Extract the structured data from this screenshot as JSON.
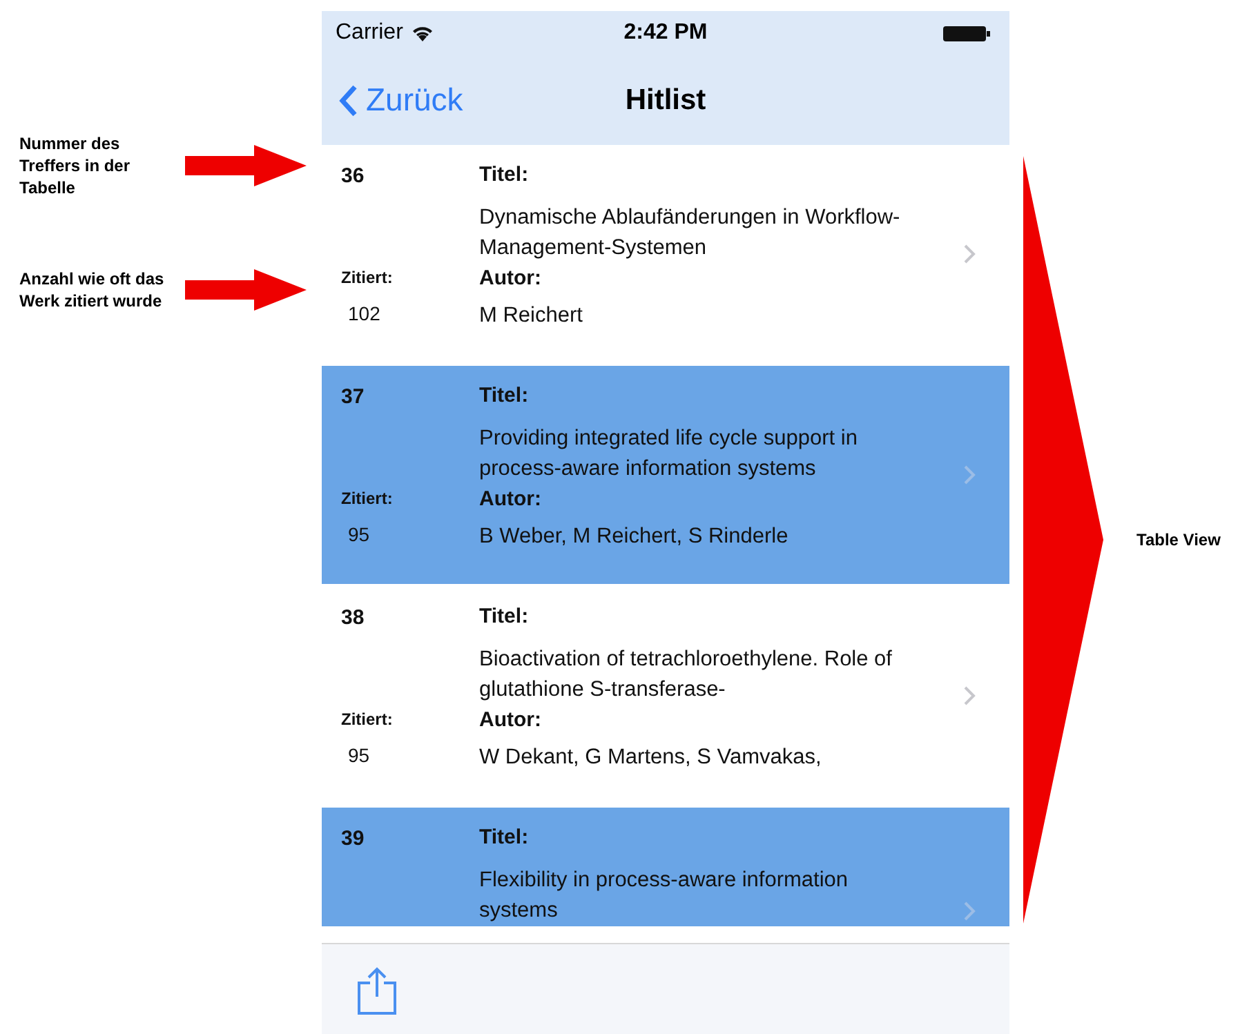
{
  "annotations": [
    {
      "text": "Nummer des Treffers in der Tabelle"
    },
    {
      "text": "Anzahl wie oft das Werk zitiert wurde"
    }
  ],
  "status_bar": {
    "carrier": "Carrier",
    "time": "2:42 PM"
  },
  "nav_bar": {
    "back": "Zurück",
    "title": "Hitlist"
  },
  "rows": [
    {
      "number": "36",
      "title_label": "Titel:",
      "title": "Dynamische Ablaufänderungen in Workflow-Management-Systemen",
      "cited_label": "Zitiert:",
      "cited": "102",
      "author_label": "Autor:",
      "author": "M Reichert",
      "highlighted": false
    },
    {
      "number": "37",
      "title_label": "Titel:",
      "title": "Providing integrated life cycle support in process-aware information systems",
      "cited_label": "Zitiert:",
      "cited": "95",
      "author_label": "Autor:",
      "author": "B Weber, M Reichert, S Rinderle",
      "highlighted": true
    },
    {
      "number": "38",
      "title_label": "Titel:",
      "title": "Bioactivation of tetrachloroethylene. Role of glutathione S-transferase-",
      "cited_label": "Zitiert:",
      "cited": "95",
      "author_label": "Autor:",
      "author": "W Dekant, G Martens, S Vamvakas,",
      "highlighted": false
    },
    {
      "number": "39",
      "title_label": "Titel:",
      "title": "Flexibility in process-aware information systems",
      "highlighted": true
    }
  ],
  "side_label": "Table View"
}
